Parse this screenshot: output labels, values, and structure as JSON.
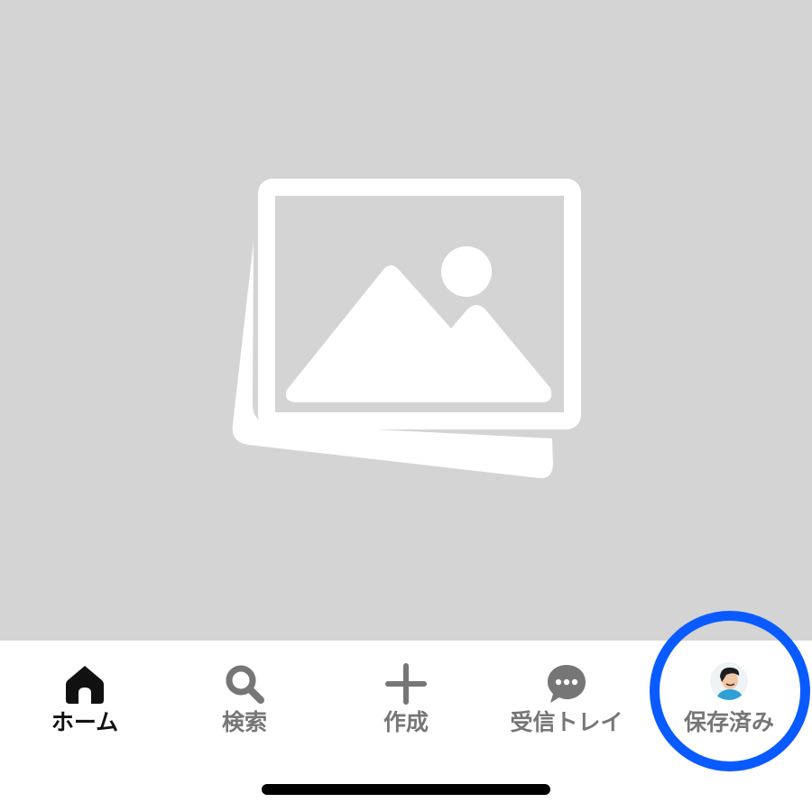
{
  "image_placeholder": {
    "icon": "image-placeholder-icon",
    "background_color": "#d4d4d4"
  },
  "tabbar": {
    "tabs": [
      {
        "id": "home",
        "label": "ホーム",
        "icon": "home-icon",
        "active": true
      },
      {
        "id": "search",
        "label": "検索",
        "icon": "search-icon",
        "active": false
      },
      {
        "id": "create",
        "label": "作成",
        "icon": "plus-icon",
        "active": false
      },
      {
        "id": "inbox",
        "label": "受信トレイ",
        "icon": "chat-bubble-icon",
        "active": false
      },
      {
        "id": "saved",
        "label": "保存済み",
        "icon": "avatar",
        "active": false
      }
    ],
    "active_color": "#111111",
    "inactive_color": "#767676"
  },
  "highlight": {
    "target": "saved",
    "color": "#0a5bff"
  }
}
